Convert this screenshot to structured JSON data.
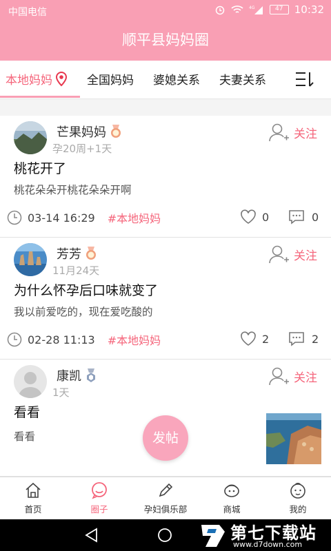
{
  "status_bar": {
    "carrier": "中国电信",
    "time": "10:32",
    "battery": "47",
    "network": "4G"
  },
  "header": {
    "title": "顺平县妈妈圈"
  },
  "tabs": [
    {
      "label": "本地妈妈",
      "active": true
    },
    {
      "label": "全国妈妈",
      "active": false
    },
    {
      "label": "婆媳关系",
      "active": false
    },
    {
      "label": "夫妻关系",
      "active": false
    }
  ],
  "posts": [
    {
      "username": "芒果妈妈",
      "subinfo": "孕20周+1天",
      "follow_label": "关注",
      "title": "桃花开了",
      "body": "桃花朵朵开桃花朵朵开啊",
      "time": "03-14 16:29",
      "tag": "#本地妈妈",
      "likes": "0",
      "comments": "0"
    },
    {
      "username": "芳芳",
      "subinfo": "11月24天",
      "follow_label": "关注",
      "title": "为什么怀孕后口味就变了",
      "body": "我以前爱吃的，现在爱吃酸的",
      "time": "02-28 11:13",
      "tag": "#本地妈妈",
      "likes": "2",
      "comments": "2"
    },
    {
      "username": "康凯",
      "subinfo": "1天",
      "follow_label": "关注",
      "title": "看看",
      "body": "看看"
    }
  ],
  "fab": {
    "label": "发帖"
  },
  "bottom_nav": [
    {
      "label": "首页",
      "icon": "home-icon",
      "active": false
    },
    {
      "label": "圈子",
      "icon": "circle-chat-icon",
      "active": true
    },
    {
      "label": "孕妇俱乐部",
      "icon": "pen-icon",
      "active": false
    },
    {
      "label": "商城",
      "icon": "shop-icon",
      "active": false
    },
    {
      "label": "我的",
      "icon": "baby-face-icon",
      "active": false
    }
  ],
  "watermark": {
    "title": "第七下载站",
    "url": "www.d7down.com"
  },
  "colors": {
    "brand": "#f99fb4",
    "accent": "#f5657b"
  }
}
